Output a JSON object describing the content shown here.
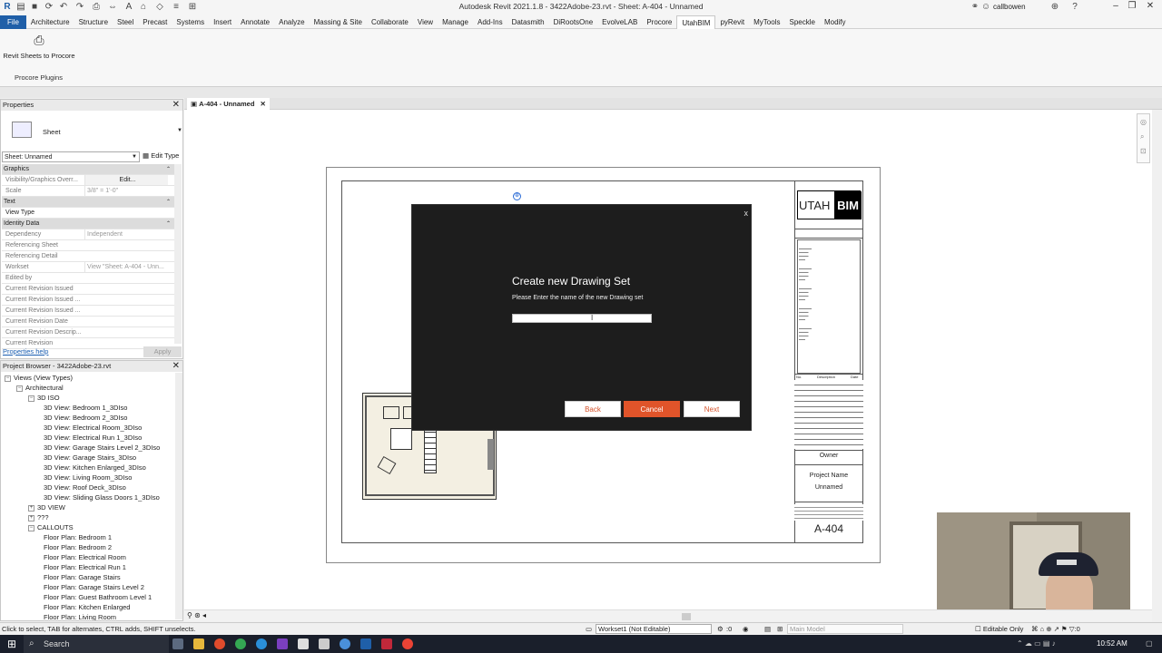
{
  "window": {
    "title": "Autodesk Revit 2021.1.8 - 3422Adobe-23.rvt - Sheet: A-404 - Unnamed",
    "user": "callbowen"
  },
  "ribbon": {
    "tabs": [
      "File",
      "Architecture",
      "Structure",
      "Steel",
      "Precast",
      "Systems",
      "Insert",
      "Annotate",
      "Analyze",
      "Massing & Site",
      "Collaborate",
      "View",
      "Manage",
      "Add-Ins",
      "Datasmith",
      "DiRootsOne",
      "EvolveLAB",
      "Procore",
      "UtahBIM",
      "pyRevit",
      "MyTools",
      "Speckle",
      "Modify"
    ],
    "active_tab": "UtahBIM",
    "button_label": "Revit Sheets to Procore",
    "panel_label": "Procore Plugins"
  },
  "properties": {
    "header": "Properties",
    "type_name": "Sheet",
    "selector": "Sheet: Unnamed",
    "edit_type": "Edit Type",
    "rows": [
      {
        "k": "Graphics",
        "v": "",
        "group": true
      },
      {
        "k": "Visibility/Graphics Overr...",
        "v": "Edit...",
        "button": true
      },
      {
        "k": "Scale",
        "v": "3/8\" = 1'-0\""
      },
      {
        "k": "Text",
        "v": "",
        "group": true
      },
      {
        "k": "View Type",
        "v": "",
        "dark": true
      },
      {
        "k": "Identity Data",
        "v": "",
        "group": true
      },
      {
        "k": "Dependency",
        "v": "Independent"
      },
      {
        "k": "Referencing Sheet",
        "v": ""
      },
      {
        "k": "Referencing Detail",
        "v": ""
      },
      {
        "k": "Workset",
        "v": "View \"Sheet: A-404 - Unn..."
      },
      {
        "k": "Edited by",
        "v": ""
      },
      {
        "k": "Current Revision Issued",
        "v": ""
      },
      {
        "k": "Current Revision Issued ...",
        "v": ""
      },
      {
        "k": "Current Revision Issued ...",
        "v": ""
      },
      {
        "k": "Current Revision Date",
        "v": ""
      },
      {
        "k": "Current Revision Descrip...",
        "v": ""
      },
      {
        "k": "Current Revision",
        "v": ""
      }
    ],
    "help_link": "Properties help",
    "apply": "Apply"
  },
  "browser": {
    "header": "Project Browser - 3422Adobe-23.rvt",
    "items": [
      {
        "label": "Views (View Types)",
        "level": 0,
        "exp": "−"
      },
      {
        "label": "Architectural",
        "level": 1,
        "exp": "−"
      },
      {
        "label": "3D ISO",
        "level": 2,
        "exp": "−"
      },
      {
        "label": "3D View: Bedroom 1_3DIso",
        "level": 3
      },
      {
        "label": "3D View: Bedroom 2_3DIso",
        "level": 3
      },
      {
        "label": "3D View: Electrical Room_3DIso",
        "level": 3
      },
      {
        "label": "3D View: Electrical Run 1_3DIso",
        "level": 3
      },
      {
        "label": "3D View: Garage Stairs Level 2_3DIso",
        "level": 3
      },
      {
        "label": "3D View: Garage Stairs_3DIso",
        "level": 3
      },
      {
        "label": "3D View: Kitchen Enlarged_3DIso",
        "level": 3
      },
      {
        "label": "3D View: Living Room_3DIso",
        "level": 3
      },
      {
        "label": "3D View: Roof Deck_3DIso",
        "level": 3
      },
      {
        "label": "3D View: Sliding Glass Doors 1_3DIso",
        "level": 3
      },
      {
        "label": "3D VIEW",
        "level": 2,
        "exp": "+"
      },
      {
        "label": "???",
        "level": 2,
        "exp": "+"
      },
      {
        "label": "CALLOUTS",
        "level": 2,
        "exp": "−"
      },
      {
        "label": "Floor Plan: Bedroom 1",
        "level": 3
      },
      {
        "label": "Floor Plan: Bedroom 2",
        "level": 3
      },
      {
        "label": "Floor Plan: Electrical Room",
        "level": 3
      },
      {
        "label": "Floor Plan: Electrical Run 1",
        "level": 3
      },
      {
        "label": "Floor Plan: Garage Stairs",
        "level": 3
      },
      {
        "label": "Floor Plan: Garage Stairs Level 2",
        "level": 3
      },
      {
        "label": "Floor Plan: Guest Bathroom Level 1",
        "level": 3
      },
      {
        "label": "Floor Plan: Kitchen Enlarged",
        "level": 3
      },
      {
        "label": "Floor Plan: Living Room",
        "level": 3
      }
    ]
  },
  "view_tab": "A-404 - Unnamed",
  "sheet": {
    "logo_left": "UTAH",
    "logo_right": "BIM",
    "owner": "Owner",
    "project_name": "Project Name",
    "unnamed": "Unnamed",
    "sheet_number": "A-404",
    "revision_header_no": "No.",
    "revision_header_desc": "Description",
    "revision_header_date": "Date"
  },
  "dialog": {
    "close": "x",
    "title": "Create new Drawing Set",
    "subtitle": "Please Enter the name of the new Drawing set",
    "input_value": "",
    "back": "Back",
    "cancel": "Cancel",
    "next": "Next"
  },
  "status": {
    "message": "Click to select, TAB for alternates, CTRL adds, SHIFT unselects.",
    "workset": "Workset1 (Not Editable)",
    "model": "Main Model",
    "editable_only": "Editable Only",
    "zero": ":0"
  },
  "taskbar": {
    "search": "Search",
    "time": "10:52 AM"
  }
}
